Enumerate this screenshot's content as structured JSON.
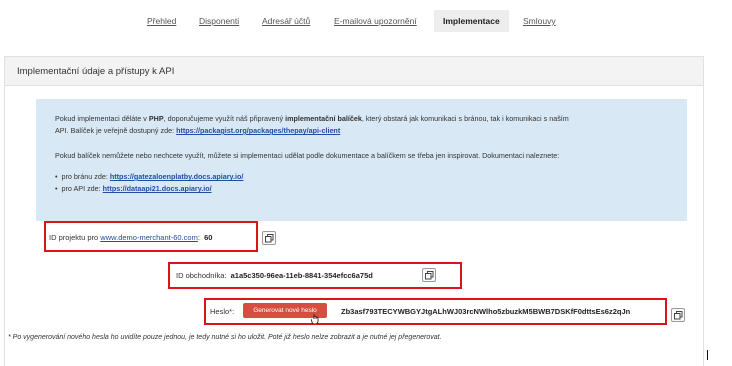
{
  "tabs": [
    {
      "label": "Přehled"
    },
    {
      "label": "Disponenti"
    },
    {
      "label": "Adresář účtů"
    },
    {
      "label": "E-mailová upozornění"
    },
    {
      "label": "Implementace"
    },
    {
      "label": "Smlouvy"
    }
  ],
  "panel": {
    "title": "Implementační údaje a přístupy k API"
  },
  "info": {
    "p1_a": "Pokud implementaci děláte v",
    "p1_b": "PHP",
    "p1_c": ", doporučujeme využít náš připravený",
    "p1_d": "implementační balíček",
    "p1_e": ", který obstará jak komunikaci s bránou, tak i komunikaci s naším",
    "p1_line2": "API. Balíček je veřejně dostupný zde:",
    "p1_link": "https://packagist.org/packages/thepay/api-client",
    "p2": "Pokud balíček nemůžete nebo nechcete využít, můžete si implementaci udělat podle dokumentace a balíčkem se třeba jen inspirovat. Dokumentaci naleznete:",
    "b1_label": "pro bránu zde:",
    "b1_link": "https://gatezaloenplatby.docs.apiary.io/",
    "b2_label": "pro API zde:",
    "b2_link": "https://dataapi21.docs.apiary.io/"
  },
  "project": {
    "label": "ID projektu pro",
    "link": "www.demo-merchant-60.com",
    "colon": ":",
    "value": "60"
  },
  "merchant": {
    "label": "ID obchodníka:",
    "value": "a1a5c350-96ea-11eb-8841-354efcc6a75d"
  },
  "password": {
    "label": "Heslo*:",
    "button": "Generovat nové heslo",
    "value": "Zb3asf793TECYWBGYJtgALhWJ03rcNWlho5zbuzkM5BWB7DSKfF0dttsEs6z2qJn"
  },
  "footnote": "* Po vygenerování nového hesla ho uvidíte pouze jednou, je tedy nutné si ho uložit. Poté již heslo nelze zobrazit a je nutné jej přegenerovat.",
  "colors": {
    "accent_red": "#d9141b",
    "button": "#d64e3f",
    "info_bg": "#d9e8f5",
    "link": "#1f4fa0"
  }
}
